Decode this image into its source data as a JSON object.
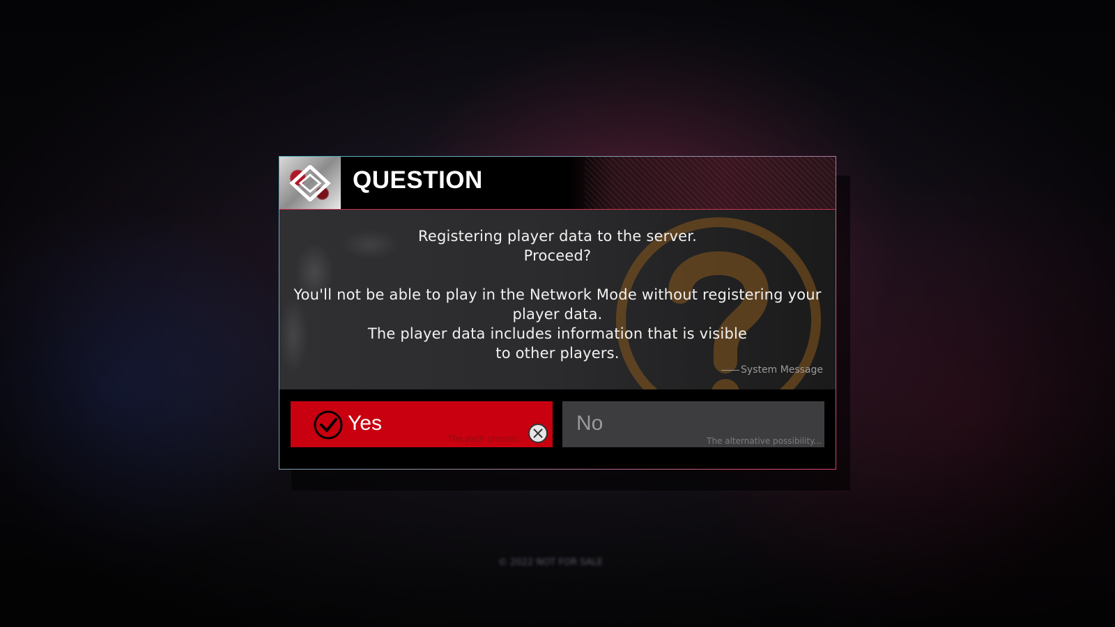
{
  "dialog": {
    "title": "QUESTION",
    "message_lines": [
      "Registering player data to the server.",
      "Proceed?",
      "You'll not be able to play in the Network Mode without registering your",
      "player data.",
      "The player data includes information that is visible",
      "to other players."
    ],
    "signature": "System Message"
  },
  "buttons": {
    "yes": {
      "label": "Yes",
      "hint": "The path chosen...",
      "icon": "check-circle-icon",
      "confirm_icon": "cross-button-icon"
    },
    "no": {
      "label": "No",
      "hint": "The alternative possibility..."
    }
  },
  "colors": {
    "accent_red": "#c8000f",
    "no_button": "#3d3d3f",
    "header_border": "#c8344f",
    "frame_cyan": "#4fb7c8"
  },
  "footer": {
    "copyright": "© 2022 NOT FOR SALE"
  }
}
